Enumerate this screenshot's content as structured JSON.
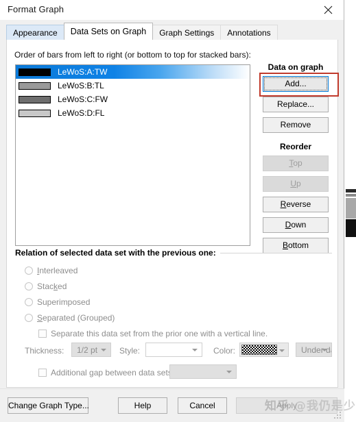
{
  "window": {
    "title": "Format Graph",
    "close_icon": "close-icon"
  },
  "tabs": [
    {
      "label": "Appearance",
      "active": false
    },
    {
      "label": "Data Sets on Graph",
      "active": true
    },
    {
      "label": "Graph Settings",
      "active": false
    },
    {
      "label": "Annotations",
      "active": false
    }
  ],
  "main": {
    "order_label": "Order of bars from left to right (or bottom to top for stacked bars):",
    "list_items": [
      {
        "label": "LeWoS:A:TW",
        "swatch": "#000000",
        "selected": true
      },
      {
        "label": "LeWoS:B:TL",
        "swatch": "#9a9a9a",
        "selected": false
      },
      {
        "label": "LeWoS:C:FW",
        "swatch": "#6e6e6e",
        "selected": false
      },
      {
        "label": "LeWoS:D:FL",
        "swatch": "#c8c8c8",
        "selected": false
      }
    ]
  },
  "data_on_graph": {
    "title": "Data on graph",
    "add_label": "Add...",
    "replace_label": "Replace...",
    "remove_label": "Remove",
    "highlight_color": "#c0392b"
  },
  "reorder": {
    "title": "Reorder",
    "buttons": [
      {
        "label": "Top",
        "disabled": true
      },
      {
        "label": "Up",
        "disabled": true
      },
      {
        "label": "Reverse",
        "disabled": false
      },
      {
        "label": "Down",
        "disabled": false
      },
      {
        "label": "Bottom",
        "disabled": false
      }
    ]
  },
  "relation": {
    "legend": "Relation of selected data set with the previous one:",
    "options": [
      {
        "label": "Interleaved",
        "selected": false
      },
      {
        "label": "Stacked",
        "selected": false
      },
      {
        "label": "Superimposed",
        "selected": false
      },
      {
        "label": "Separated (Grouped)",
        "selected": false
      }
    ],
    "separate_checkbox": {
      "label": "Separate this data set from the prior one with a vertical line.",
      "checked": false
    },
    "thickness_label": "Thickness:",
    "thickness_value": "1/2 pt",
    "style_label": "Style:",
    "style_value": "",
    "color_label": "Color:",
    "color_value": "checkered-black-white",
    "position_value": "Under data points",
    "gap_checkbox": {
      "label": "Additional gap between data sets",
      "checked": false
    },
    "gap_value": ""
  },
  "footer": {
    "change_graph_type": "Change Graph Type...",
    "help": "Help",
    "cancel": "Cancel",
    "apply": "Apply"
  },
  "watermark": {
    "site": "知乎",
    "handle": "@我仍是少年"
  }
}
